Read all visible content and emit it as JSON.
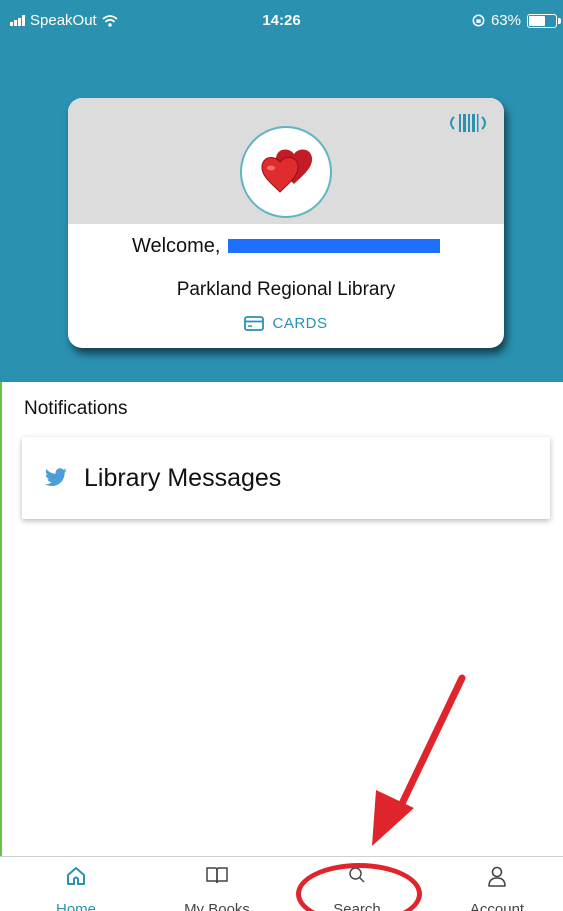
{
  "status_bar": {
    "carrier": "SpeakOut",
    "time": "14:26",
    "battery_percent": "63%",
    "battery_level": 0.63
  },
  "card": {
    "welcome_text": "Welcome,",
    "library_name": "Parkland Regional Library",
    "cards_label": "CARDS"
  },
  "notifications": {
    "title": "Notifications",
    "items": [
      {
        "label": "Library Messages",
        "icon": "twitter-bird-icon"
      }
    ]
  },
  "tabs": [
    {
      "label": "Home",
      "icon": "home-icon",
      "active": true
    },
    {
      "label": "My Books",
      "icon": "book-icon",
      "active": false
    },
    {
      "label": "Search",
      "icon": "search-icon",
      "active": false
    },
    {
      "label": "Account",
      "icon": "person-icon",
      "active": false
    }
  ],
  "colors": {
    "brand": "#2a91b1",
    "annotation_red": "#e0242b",
    "redaction_blue": "#1f6fff"
  }
}
